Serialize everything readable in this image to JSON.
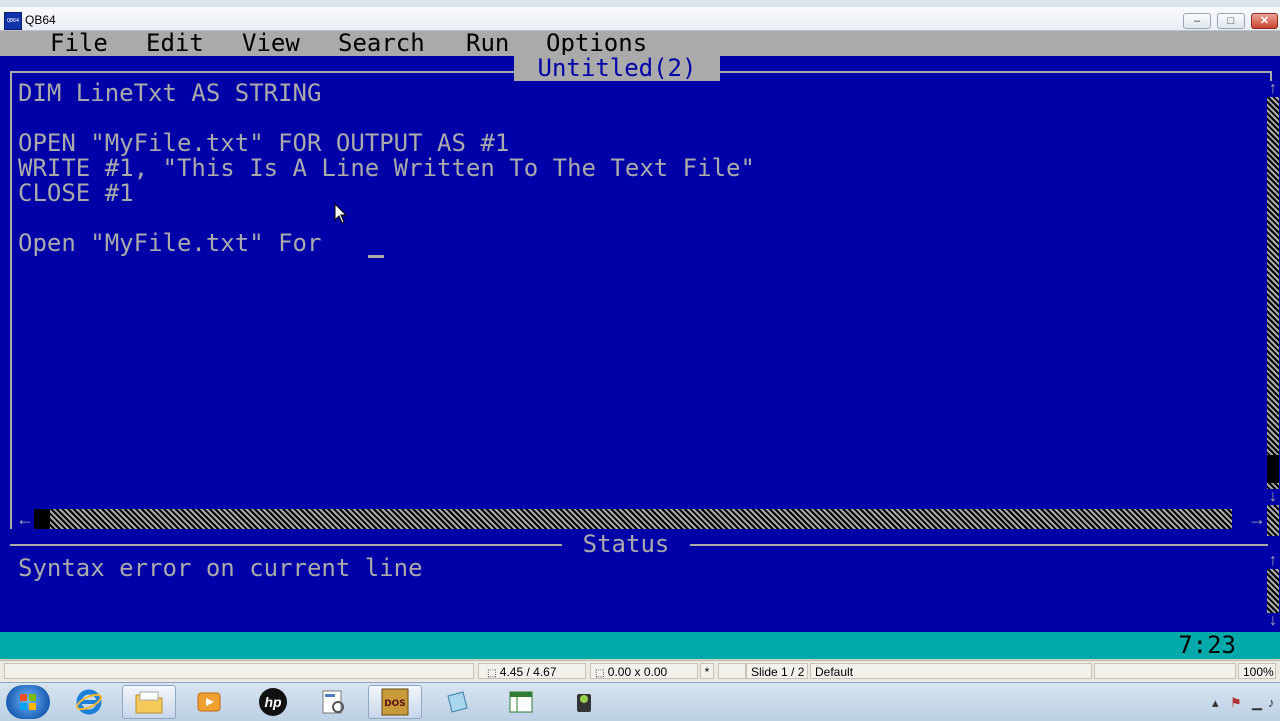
{
  "window": {
    "title": "QB64",
    "app_icon_text": "QB64"
  },
  "menu": [
    "File",
    "Edit",
    "View",
    "Search",
    "Run",
    "Options"
  ],
  "editor": {
    "title": "Untitled(2)",
    "lines": [
      "DIM LineTxt AS STRING",
      "",
      "OPEN \"MyFile.txt\" FOR OUTPUT AS #1",
      "WRITE #1, \"This Is A Line Written To The Text File\"",
      "CLOSE #1",
      "",
      "Open \"MyFile.txt\" For "
    ]
  },
  "status": {
    "title": "Status",
    "message": "Syntax error on current line"
  },
  "cursor_position": "7:23",
  "office_statusbar": {
    "position": "4.45 / 4.67",
    "size": "0.00 x 0.00",
    "modified": "*",
    "slide": "Slide 1 / 2",
    "layout": "Default",
    "zoom": "100%"
  },
  "taskbar": {
    "apps": [
      "windows-start",
      "internet-explorer",
      "file-explorer",
      "media-player",
      "hp",
      "odf-viewer",
      "dosbox",
      "notepad",
      "spreadsheet",
      "video-camera"
    ],
    "active": "dosbox"
  },
  "colors": {
    "qb_background": "#0000A8",
    "qb_foreground": "#AAAAAA",
    "qb_bottom_bar": "#00AAAA"
  }
}
